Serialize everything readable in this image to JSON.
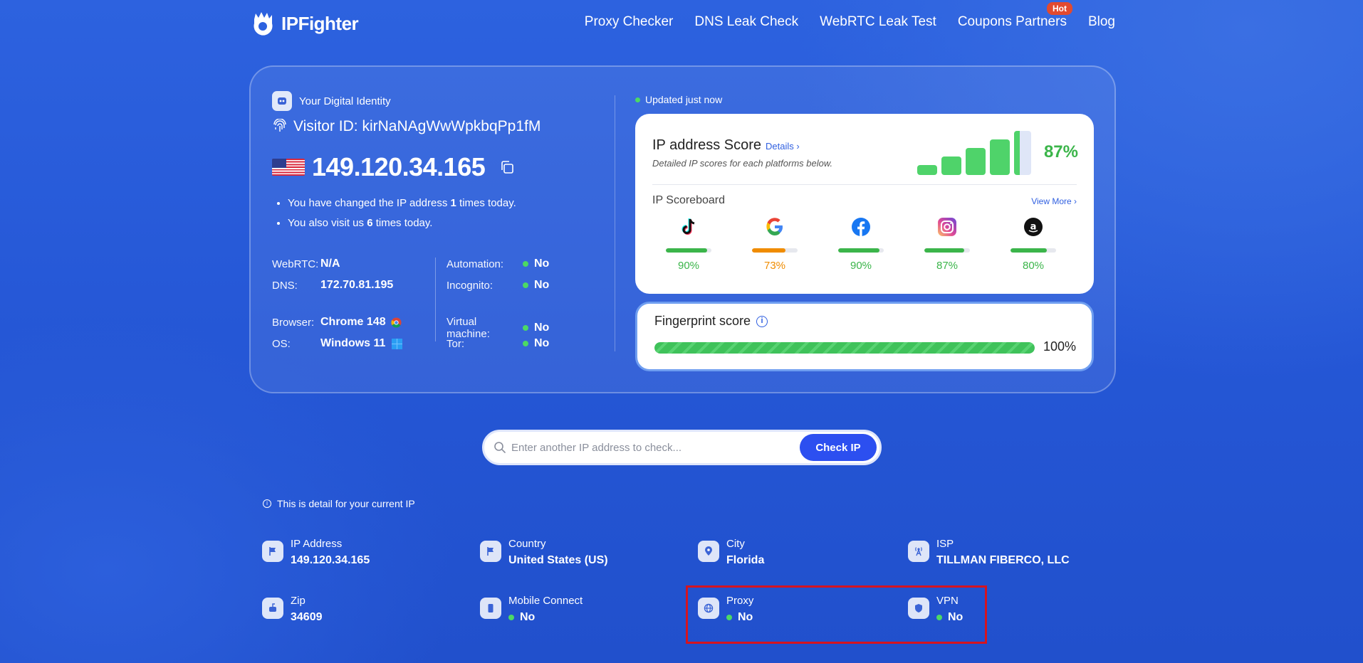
{
  "brand": {
    "name": "IPFighter"
  },
  "nav": {
    "items": [
      "Proxy Checker",
      "DNS Leak Check",
      "WebRTC Leak Test",
      "Coupons Partners",
      "Blog"
    ],
    "hot_badge": "Hot"
  },
  "identity": {
    "heading": "Your Digital Identity",
    "visitor_id": "Visitor ID: kirNaNAgWwWpkbqPp1fM",
    "ip": "149.120.34.165",
    "bullet1_pre": "You have changed the IP address ",
    "bullet1_num": "1",
    "bullet1_post": " times today.",
    "bullet2_pre": "You also visit us ",
    "bullet2_num": "6",
    "bullet2_post": " times today."
  },
  "info": {
    "webrtc_label": "WebRTC:",
    "webrtc_value": "N/A",
    "dns_label": "DNS:",
    "dns_value": "172.70.81.195",
    "browser_label": "Browser:",
    "browser_value": "Chrome 148",
    "os_label": "OS:",
    "os_value": "Windows 11",
    "automation_label": "Automation:",
    "automation_value": "No",
    "incognito_label": "Incognito:",
    "incognito_value": "No",
    "vm_label": "Virtual machine:",
    "vm_value": "No",
    "tor_label": "Tor:",
    "tor_value": "No"
  },
  "updated": "Updated just now",
  "score": {
    "title": "IP address Score",
    "details_link": "Details ›",
    "subtitle": "Detailed IP scores for each platforms below.",
    "percent": "87%",
    "percent_value": 87,
    "board_title": "IP Scoreboard",
    "view_more": "View More ›",
    "platforms": [
      {
        "name": "tiktok-icon",
        "pct": "90%",
        "value": 90,
        "color": "#3bb54a"
      },
      {
        "name": "google-icon",
        "pct": "73%",
        "value": 73,
        "color": "#f08c00"
      },
      {
        "name": "facebook-icon",
        "pct": "90%",
        "value": 90,
        "color": "#3bb54a"
      },
      {
        "name": "instagram-icon",
        "pct": "87%",
        "value": 87,
        "color": "#3bb54a"
      },
      {
        "name": "amazon-icon",
        "pct": "80%",
        "value": 80,
        "color": "#3bb54a"
      }
    ]
  },
  "fingerprint": {
    "title": "Fingerprint score",
    "percent": "100%",
    "value": 100
  },
  "search": {
    "placeholder": "Enter another IP address to check...",
    "button": "Check IP"
  },
  "detail_note": "This is detail for your current IP",
  "details": {
    "ip_label": "IP Address",
    "ip_value": "149.120.34.165",
    "country_label": "Country",
    "country_value": "United States (US)",
    "city_label": "City",
    "city_value": "Florida",
    "isp_label": "ISP",
    "isp_value": "TILLMAN FIBERCO, LLC",
    "zip_label": "Zip",
    "zip_value": "34609",
    "mobile_label": "Mobile Connect",
    "mobile_value": "No",
    "proxy_label": "Proxy",
    "proxy_value": "No",
    "vpn_label": "VPN",
    "vpn_value": "No"
  },
  "colors": {
    "accent": "#2c4ff0",
    "green": "#3bb54a",
    "highlight": "#d5141f"
  }
}
